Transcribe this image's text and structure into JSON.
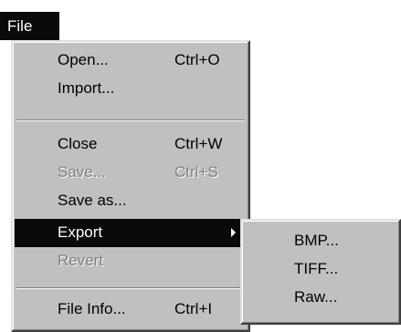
{
  "menubar": {
    "file_label": "File"
  },
  "file_menu": {
    "items": [
      {
        "label": "Open...",
        "shortcut": "Ctrl+O",
        "state": "enabled"
      },
      {
        "label": "Import...",
        "shortcut": "",
        "state": "enabled"
      },
      {
        "label": "Close",
        "shortcut": "Ctrl+W",
        "state": "enabled"
      },
      {
        "label": "Save...",
        "shortcut": "Ctrl+S",
        "state": "disabled"
      },
      {
        "label": "Save as...",
        "shortcut": "",
        "state": "enabled"
      },
      {
        "label": "Export",
        "shortcut": "",
        "state": "highlighted",
        "submenu": true
      },
      {
        "label": "Revert",
        "shortcut": "",
        "state": "disabled"
      },
      {
        "label": "File Info...",
        "shortcut": "Ctrl+I",
        "state": "enabled"
      }
    ]
  },
  "export_submenu": {
    "items": [
      {
        "label": "BMP..."
      },
      {
        "label": "TIFF..."
      },
      {
        "label": "Raw..."
      }
    ]
  },
  "colors": {
    "menu_background": "#c0c0c0",
    "highlight_background": "#0a0a0a",
    "highlight_text": "#ffffff",
    "disabled_text": "#808080"
  }
}
